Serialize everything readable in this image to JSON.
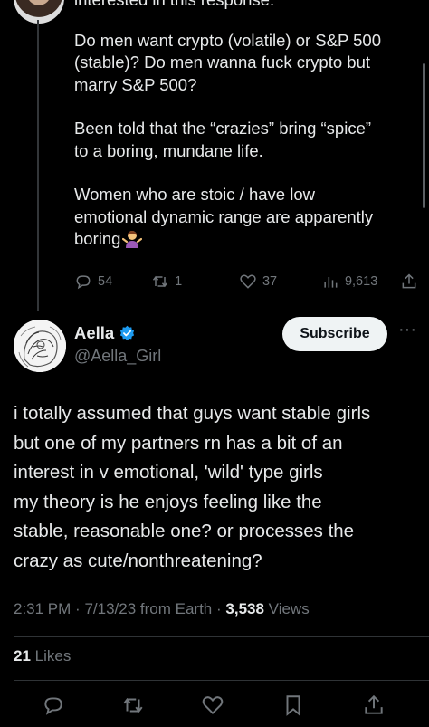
{
  "parent_tweet": {
    "partial_line": "interested in this response.",
    "paragraphs": [
      "Do men want crypto (volatile) or S&P 500\n(stable)? Do men wanna fuck crypto but\nmarry S&P 500?",
      "Been told that the “crazies” bring “spice”\nto a boring, mundane life.",
      "Women who are stoic / have low\nemotional dynamic range are apparently\nboring"
    ],
    "emoji_icon": "person-shrugging-emoji",
    "replies": "54",
    "retweets": "1",
    "likes": "37",
    "views": "9,613"
  },
  "tweet": {
    "author_name": "Aella",
    "author_handle": "@Aella_Girl",
    "verified_icon": "verified-badge-icon",
    "subscribe_label": "Subscribe",
    "more_icon": "more-options-icon",
    "text": "i totally assumed that guys want stable girls\nbut one of my partners rn has a bit of an\ninterest in v emotional, 'wild' type girls\nmy theory is he enjoys feeling like the\nstable, reasonable one? or processes the\ncrazy as cute/nonthreatening?",
    "time": "2:31 PM",
    "date": "7/13/23",
    "source": "from Earth",
    "views_count": "3,538",
    "views_label": "Views",
    "likes_count": "21",
    "likes_label": "Likes"
  },
  "colors": {
    "background": "#000000",
    "text": "#e7e9ea",
    "muted": "#71767b",
    "verified": "#1d9bf0"
  }
}
